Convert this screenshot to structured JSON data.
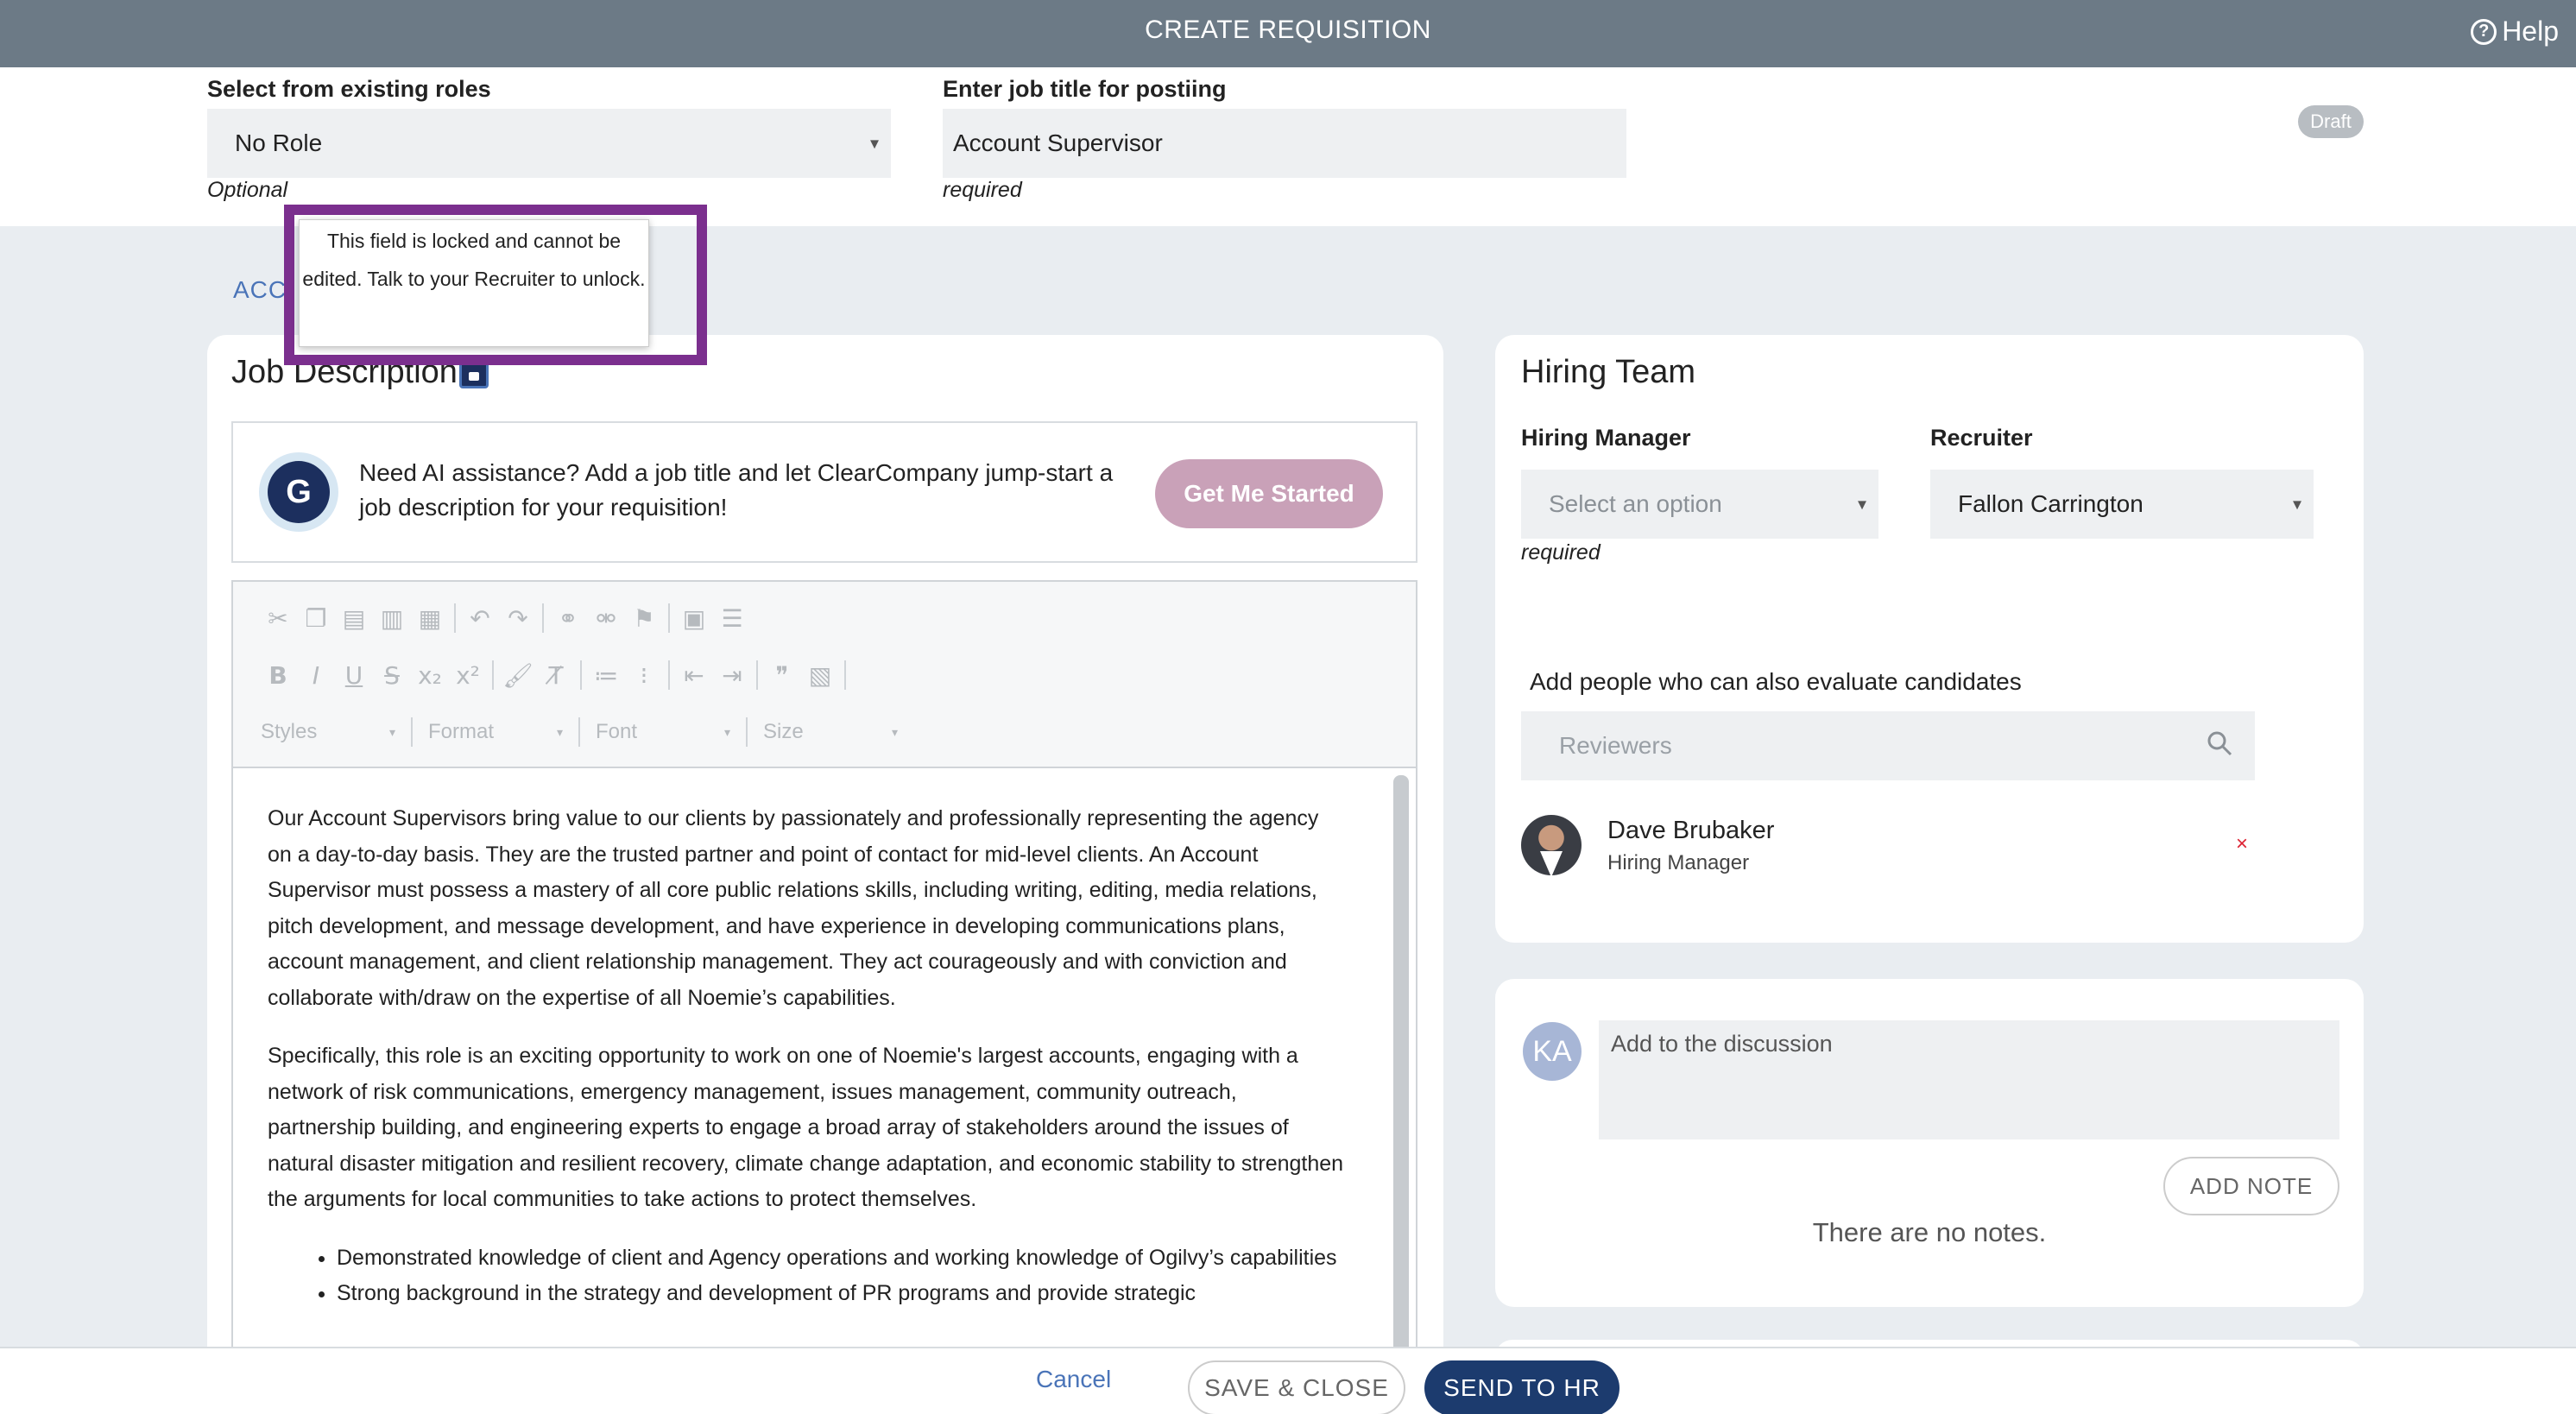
{
  "header": {
    "title": "CREATE REQUISITION",
    "help_label": "Help",
    "help_icon": "question-circle-icon"
  },
  "role_select": {
    "label": "Select from existing roles",
    "value": "No Role",
    "hint": "Optional"
  },
  "job_title": {
    "label": "Enter job title for postiing",
    "value": "Account Supervisor",
    "hint": "required"
  },
  "status": {
    "badge": "Draft"
  },
  "tab": {
    "label": "ACC"
  },
  "tooltip": {
    "text": "This field is locked and cannot be edited. Talk to your Recruiter to unlock."
  },
  "job_description": {
    "title": "Job Description",
    "lock_icon": "lock-icon",
    "ai": {
      "text": "Need AI assistance? Add a job title and let ClearCompany jump-start a job description for your requisition!",
      "button": "Get Me Started",
      "logo_letter": "G"
    },
    "toolbar": {
      "combos": [
        "Styles",
        "Format",
        "Font",
        "Size"
      ]
    },
    "paragraphs": [
      "Our Account Supervisors bring value to our clients by passionately and professionally representing the agency on a day-to-day basis. They are the trusted partner and point of contact for mid-level clients. An Account Supervisor must possess a mastery of all core public relations skills, including writing, editing, media relations, pitch development, and message development, and have experience in developing communications plans, account management, and client relationship management. They act courageously and with conviction and collaborate with/draw on the expertise of all Noemie’s capabilities.",
      "Specifically, this role is an exciting opportunity to work on one of Noemie's largest accounts, engaging with a network of risk communications, emergency management, issues management, community outreach, partnership building, and engineering experts to engage a broad array of stakeholders around the issues of natural disaster mitigation and resilient recovery, climate change adaptation, and economic stability to strengthen the arguments for local communities to take actions to protect themselves."
    ],
    "bullets": [
      "Demonstrated knowledge of client and Agency operations and working knowledge of Ogilvy’s capabilities",
      "Strong background in the strategy and development of PR programs and provide strategic"
    ]
  },
  "hiring_team": {
    "title": "Hiring Team",
    "manager": {
      "label": "Hiring Manager",
      "placeholder": "Select an option",
      "hint": "required"
    },
    "recruiter": {
      "label": "Recruiter",
      "value": "Fallon Carrington"
    },
    "reviewers_label": "Add people who can also evaluate candidates",
    "reviewers_placeholder": "Reviewers",
    "members": [
      {
        "name": "Dave Brubaker",
        "role": "Hiring Manager",
        "remove": "×"
      }
    ]
  },
  "discussion": {
    "avatar_initials": "KA",
    "placeholder": "Add to the discussion",
    "add_button": "ADD NOTE",
    "empty_text": "There are no notes."
  },
  "footer": {
    "cancel": "Cancel",
    "save": "SAVE & CLOSE",
    "send": "SEND TO HR"
  },
  "colors": {
    "header_bg": "#6c7a86",
    "brand_navy": "#1c3b6e",
    "highlight_frame": "#7b2f8e",
    "link": "#4a74b8",
    "ai_button": "#c9a1b8"
  }
}
